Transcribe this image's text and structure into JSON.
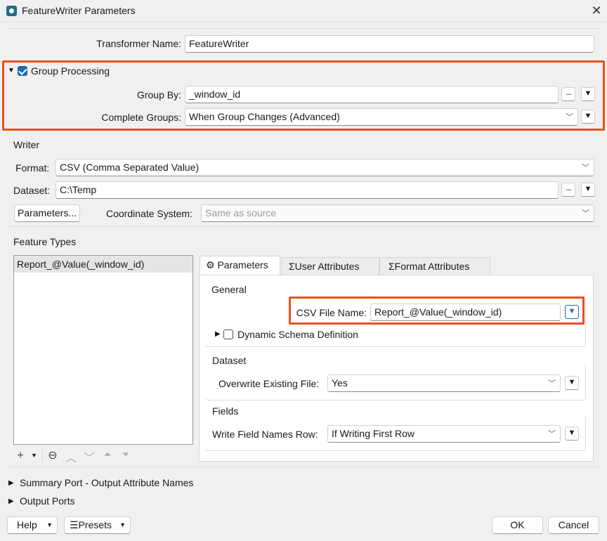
{
  "window": {
    "title": "FeatureWriter Parameters"
  },
  "transformer": {
    "label": "Transformer Name:",
    "value": "FeatureWriter"
  },
  "group_processing": {
    "label": "Group Processing",
    "checked": true,
    "group_by_label": "Group By:",
    "group_by_value": "_window_id",
    "complete_groups_label": "Complete Groups:",
    "complete_groups_value": "When Group Changes (Advanced)"
  },
  "writer": {
    "section_label": "Writer",
    "format_label": "Format:",
    "format_value": "CSV (Comma Separated Value)",
    "dataset_label": "Dataset:",
    "dataset_value": "C:\\Temp",
    "parameters_button": "Parameters...",
    "coord_label": "Coordinate System:",
    "coord_placeholder": "Same as source"
  },
  "feature_types": {
    "section_label": "Feature Types",
    "items": [
      "Report_@Value(_window_id)"
    ],
    "tabs": [
      "Parameters",
      "User Attributes",
      "Format Attributes"
    ],
    "general": {
      "label": "General",
      "csv_label": "CSV File Name:",
      "csv_value": "Report_@Value(_window_id)",
      "dynamic_schema_label": "Dynamic Schema Definition"
    },
    "dataset": {
      "label": "Dataset",
      "overwrite_label": "Overwrite Existing File:",
      "overwrite_value": "Yes"
    },
    "fields": {
      "label": "Fields",
      "write_names_label": "Write Field Names Row:",
      "write_names_value": "If Writing First Row"
    }
  },
  "collapsed_sections": {
    "summary_port": "Summary Port - Output Attribute Names",
    "output_ports": "Output Ports"
  },
  "footer": {
    "help": "Help",
    "presets": "Presets",
    "ok": "OK",
    "cancel": "Cancel"
  },
  "colors": {
    "highlight": "#e8501f",
    "checkbox": "#1c6aab"
  },
  "icons": [
    "app-icon",
    "close-icon",
    "gear-icon",
    "attribute-icon",
    "ellipsis-icon",
    "dropdown-arrow-icon",
    "plus-icon",
    "minus-icon",
    "arrow-up-icon",
    "arrow-down-icon",
    "move-top-icon",
    "move-bottom-icon",
    "presets-icon"
  ]
}
